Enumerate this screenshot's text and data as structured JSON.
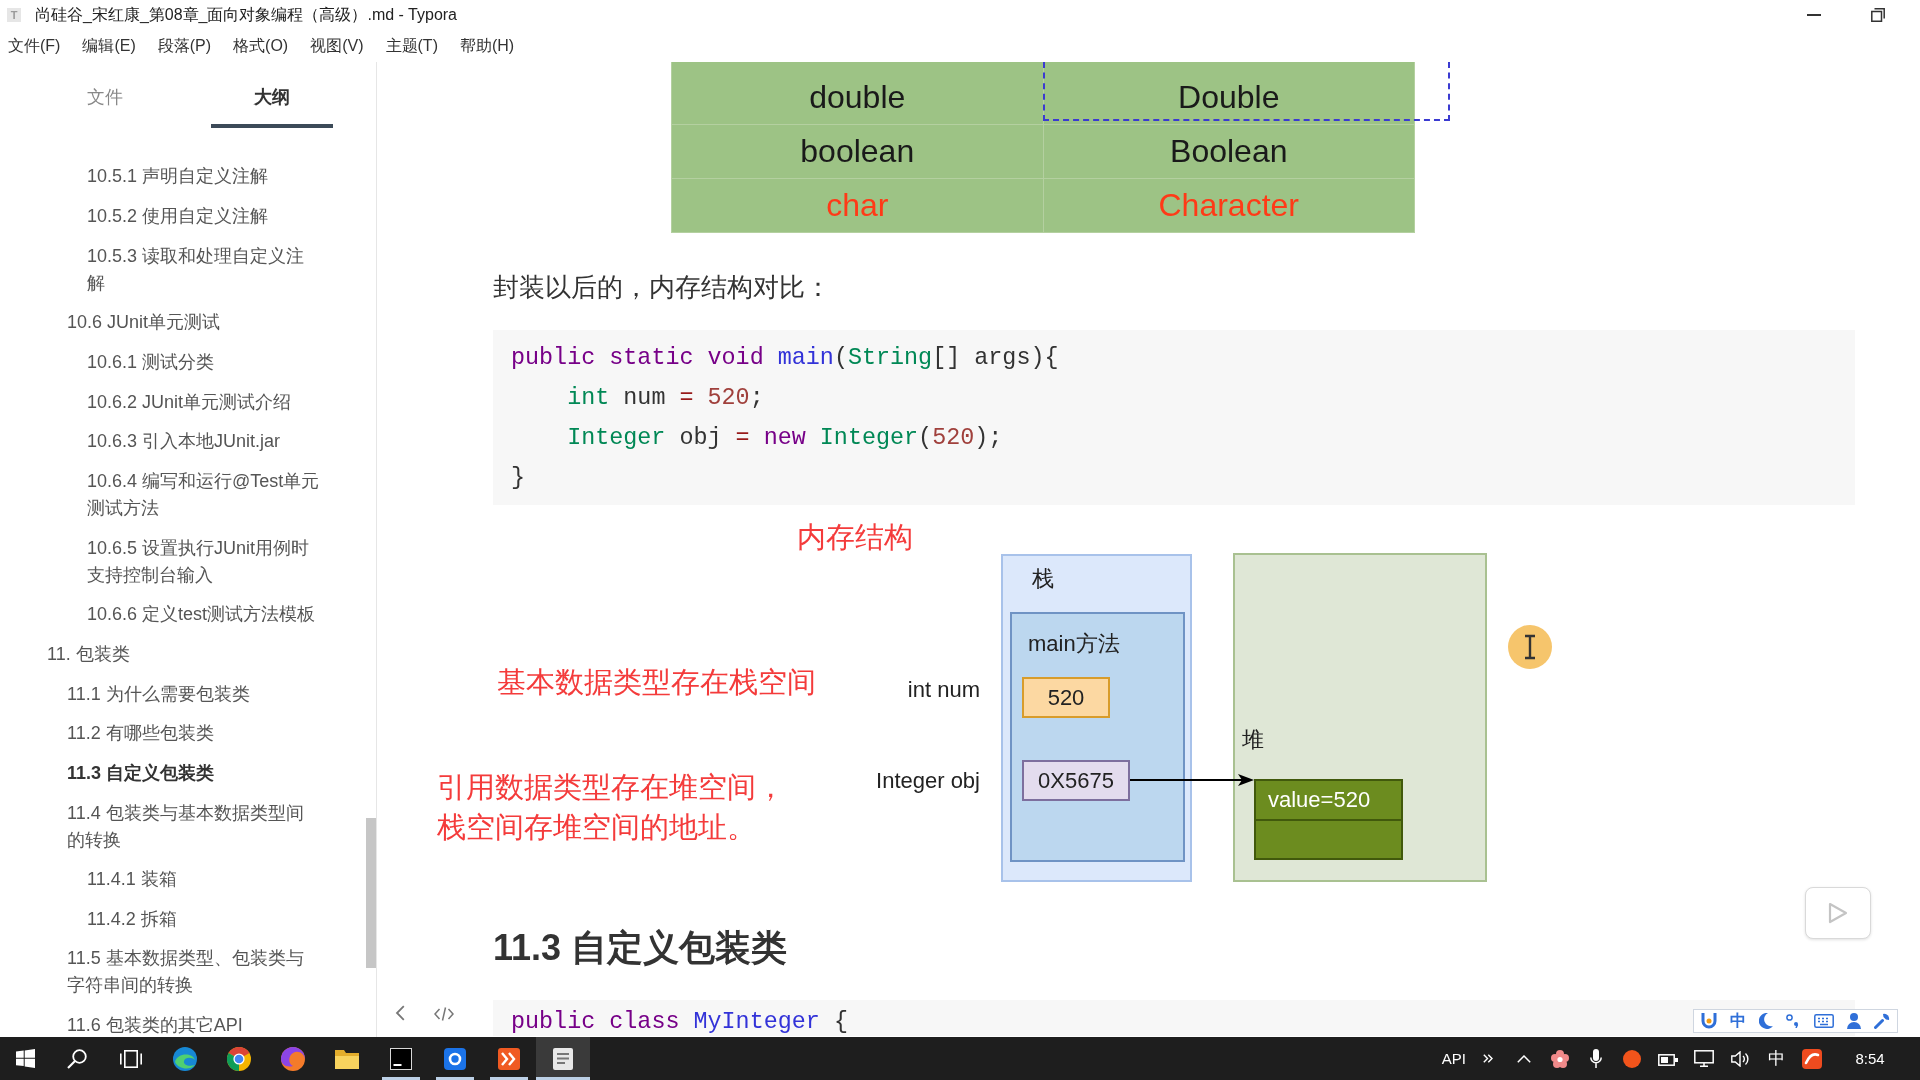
{
  "window": {
    "icon_letter": "T",
    "title": "尚硅谷_宋红康_第08章_面向对象编程（高级）.md - Typora"
  },
  "menu": [
    "文件(F)",
    "编辑(E)",
    "段落(P)",
    "格式(O)",
    "视图(V)",
    "主题(T)",
    "帮助(H)"
  ],
  "sidebar": {
    "tabs": [
      {
        "label": "文件",
        "selected": false
      },
      {
        "label": "大纲",
        "selected": true
      }
    ],
    "outline": [
      {
        "children": [
          {
            "children": [
              {
                "label": "10.5.1 声明自定义注解",
                "selected": false
              },
              {
                "label": "10.5.2 使用自定义注解",
                "selected": false
              },
              {
                "label": "10.5.3 读取和处理自定义注解",
                "selected": false
              }
            ]
          },
          {
            "label": "10.6 JUnit单元测试",
            "selected": false,
            "children": [
              {
                "label": "10.6.1 测试分类",
                "selected": false
              },
              {
                "label": "10.6.2 JUnit单元测试介绍",
                "selected": false
              },
              {
                "label": "10.6.3 引入本地JUnit.jar",
                "selected": false
              },
              {
                "label": "10.6.4 编写和运行@Test单元测试方法",
                "selected": false
              },
              {
                "label": "10.6.5 设置执行JUnit用例时支持控制台输入",
                "selected": false
              },
              {
                "label": "10.6.6 定义test测试方法模板",
                "selected": false
              }
            ]
          }
        ]
      },
      {
        "label": "11. 包装类",
        "selected": false,
        "children": [
          {
            "label": "11.1 为什么需要包装类",
            "selected": false
          },
          {
            "label": "11.2 有哪些包装类",
            "selected": false
          },
          {
            "label": "11.3 自定义包装类",
            "selected": true
          },
          {
            "label": "11.4 包装类与基本数据类型间的转换",
            "selected": false,
            "children": [
              {
                "label": "11.4.1 装箱",
                "selected": false
              },
              {
                "label": "11.4.2 拆箱",
                "selected": false
              }
            ]
          },
          {
            "label": "11.5 基本数据类型、包装类与字符串间的转换",
            "selected": false
          },
          {
            "label": "11.6 包装类的其它API",
            "selected": false
          }
        ]
      }
    ]
  },
  "document": {
    "figure": {
      "rows": [
        {
          "cells": [
            "double",
            "Double"
          ],
          "highlight": false
        },
        {
          "cells": [
            "boolean",
            "Boolean"
          ],
          "highlight": false
        },
        {
          "cells": [
            "char",
            "Character"
          ],
          "highlight": true
        }
      ]
    },
    "paragraph": "封装以后的，内存结构对比：",
    "code": [
      [
        {
          "kind": "keyword",
          "text": "public"
        },
        {
          "kind": "keyword",
          "text": " static"
        },
        {
          "kind": "keyword",
          "text": " void"
        },
        {
          "kind": "def",
          "text": " main"
        },
        {
          "kind": "plain",
          "text": "("
        },
        {
          "kind": "type",
          "text": "String"
        },
        {
          "kind": "plain",
          "text": "[] args){"
        }
      ],
      [
        {
          "kind": "type",
          "text": "    int"
        },
        {
          "kind": "plain",
          "text": " num "
        },
        {
          "kind": "operator",
          "text": "="
        },
        {
          "kind": "number",
          "text": " 520"
        },
        {
          "kind": "plain",
          "text": ";"
        }
      ],
      [
        {
          "kind": "type",
          "text": "    Integer"
        },
        {
          "kind": "plain",
          "text": " obj "
        },
        {
          "kind": "operator",
          "text": "="
        },
        {
          "kind": "keyword",
          "text": " new"
        },
        {
          "kind": "type",
          "text": " Integer"
        },
        {
          "kind": "plain",
          "text": "("
        },
        {
          "kind": "number",
          "text": "520"
        },
        {
          "kind": "plain",
          "text": ");"
        }
      ],
      [
        {
          "kind": "plain",
          "text": "}"
        }
      ]
    ],
    "diagram": {
      "title": "内存结构",
      "notes": [
        {
          "lines": [
            "基本数据类型存在栈空间"
          ]
        },
        {
          "lines": [
            "引用数据类型存在堆空间，",
            "栈空间存堆空间的地址。"
          ]
        }
      ],
      "stack": {
        "label": "栈",
        "frame": "main方法",
        "vars": [
          {
            "name": "int num",
            "value": "520",
            "kind": "primitive"
          },
          {
            "name": "Integer obj",
            "value": "0X5675",
            "kind": "reference"
          }
        ]
      },
      "heap": {
        "label": "堆",
        "object": "value=520"
      }
    },
    "heading": "11.3 自定义包装类",
    "code_2": [
      [
        {
          "kind": "keyword",
          "text": "public"
        },
        {
          "kind": "keyword",
          "text": " class"
        },
        {
          "kind": "def",
          "text": " MyInteger"
        },
        {
          "kind": "plain",
          "text": " {"
        }
      ]
    ]
  },
  "ime_bar": {
    "mode": "中"
  },
  "taskbar": {
    "apps": [
      {
        "kind": "start",
        "running": false,
        "selected": false
      },
      {
        "kind": "search",
        "running": false,
        "selected": false
      },
      {
        "kind": "task_view",
        "running": false,
        "selected": false
      },
      {
        "kind": "wave",
        "running": false,
        "selected": false
      },
      {
        "kind": "segments",
        "running": false,
        "selected": false
      },
      {
        "kind": "ball",
        "running": false,
        "selected": false
      },
      {
        "kind": "folder",
        "running": false,
        "selected": false
      },
      {
        "kind": "dark_square",
        "running": true,
        "selected": false
      },
      {
        "kind": "ring_tile",
        "running": true,
        "selected": false
      },
      {
        "kind": "chevron_tile",
        "running": true,
        "selected": false
      },
      {
        "kind": "document",
        "running": true,
        "selected": true
      }
    ],
    "tray_label": "API",
    "input_mode": "中",
    "clock": "8:54"
  }
}
